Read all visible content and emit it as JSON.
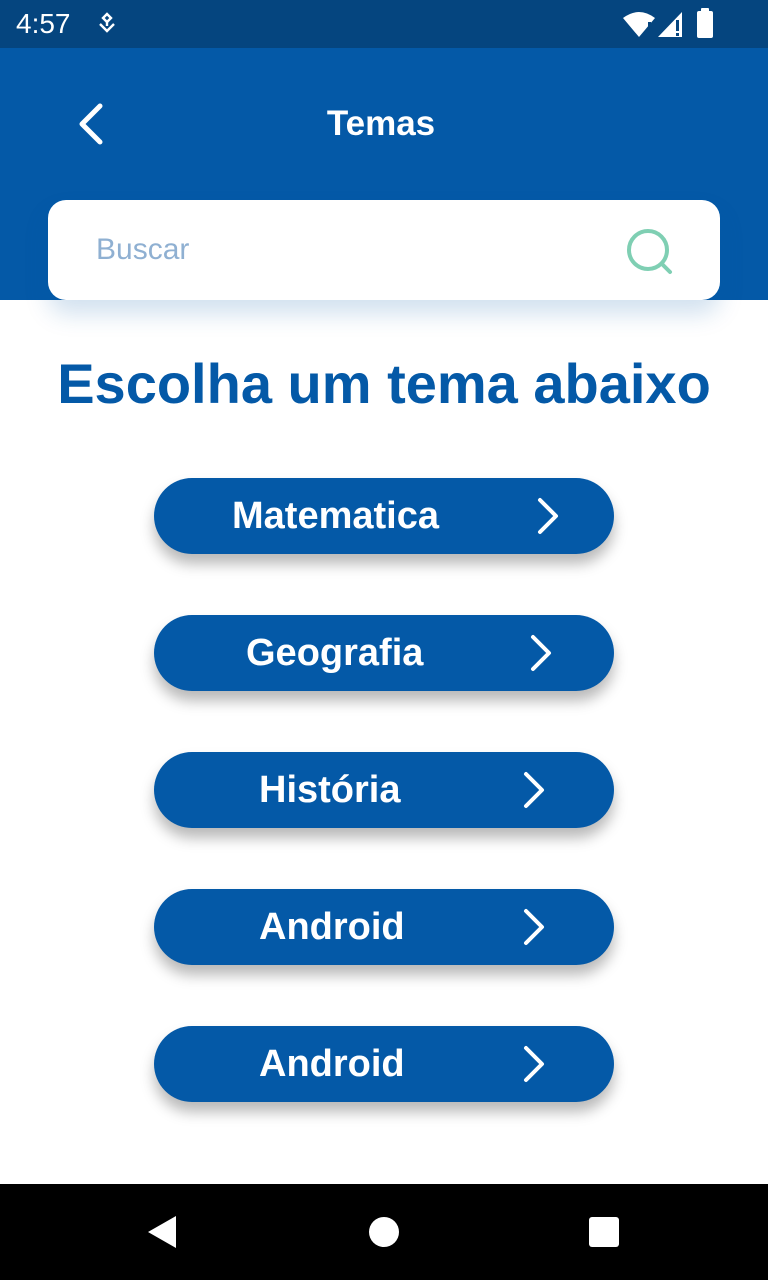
{
  "status_bar": {
    "time": "4:57",
    "icons": [
      "notification-icon",
      "wifi-icon",
      "signal-icon",
      "battery-icon"
    ]
  },
  "app_bar": {
    "title": "Temas",
    "back_icon": "back-arrow-icon"
  },
  "search": {
    "placeholder": "Buscar",
    "value": "",
    "icon": "search-icon"
  },
  "heading": "Escolha um tema abaixo",
  "themes": [
    {
      "label": "Matematica"
    },
    {
      "label": "Geografia"
    },
    {
      "label": "História"
    },
    {
      "label": "Android"
    },
    {
      "label": "Android"
    }
  ],
  "nav_bar": {
    "icons": [
      "nav-back-icon",
      "nav-home-icon",
      "nav-recents-icon"
    ]
  },
  "colors": {
    "primary": "#0459a7",
    "status_bar": "#05457f",
    "search_icon": "#7fcfb3",
    "placeholder": "#8fb0d2",
    "background": "#ffffff"
  }
}
